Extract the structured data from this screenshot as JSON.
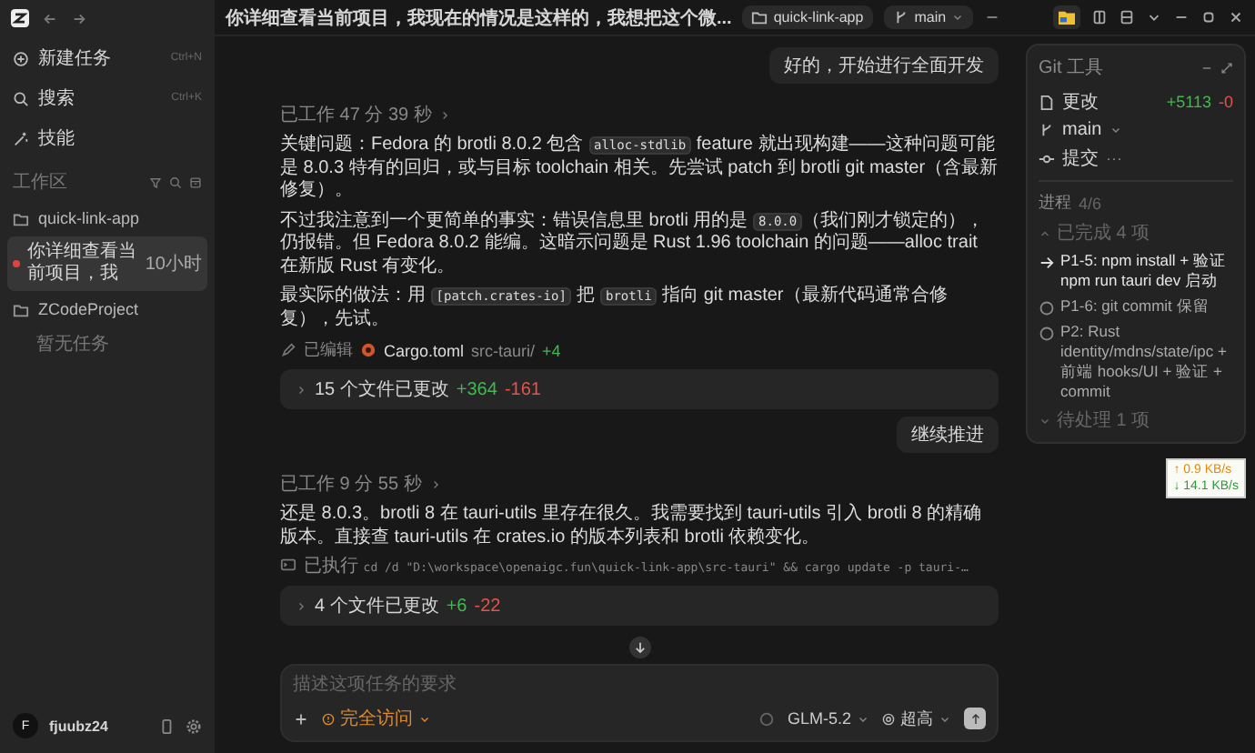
{
  "sidebar": {
    "nav": [
      {
        "kind": "new",
        "label": "新建任务",
        "shortcut": "Ctrl+N"
      },
      {
        "kind": "search",
        "label": "搜索",
        "shortcut": "Ctrl+K"
      },
      {
        "kind": "skills",
        "label": "技能"
      }
    ],
    "workspace_label": "工作区",
    "projects": [
      {
        "name": "quick-link-app",
        "tasks": [
          {
            "title": "你详细查看当前项目，我",
            "time": "10小时",
            "selected": true,
            "color": "#e0443e"
          }
        ]
      },
      {
        "name": "ZCodeProject",
        "empty": "暂无任务"
      }
    ],
    "user": {
      "initial": "F",
      "name": "fjuubz24"
    }
  },
  "topbar": {
    "title": "你详细查看当前项目，我现在的情况是这样的，我想把这个微...",
    "project": "quick-link-app",
    "branch": "main"
  },
  "messages": [
    {
      "kind": "user",
      "text": "好的，开始进行全面开发"
    },
    {
      "kind": "worked",
      "text": "已工作 47 分 39 秒"
    },
    {
      "kind": "text",
      "segments": [
        {
          "kind": "text",
          "text": "关键问题：Fedora 的 brotli 8.0.2 包含 "
        },
        {
          "kind": "code",
          "text": "alloc-stdlib"
        },
        {
          "kind": "text",
          "text": " feature 就出现构建——这种问题可能是 8.0.3 特有的回归，或与目标 toolchain 相关。先尝试 patch 到 brotli git master（含最新修复）。"
        }
      ]
    },
    {
      "kind": "text",
      "segments": [
        {
          "kind": "text",
          "text": "不过我注意到一个更简单的事实：错误信息里 brotli 用的是 "
        },
        {
          "kind": "code",
          "text": "8.0.0"
        },
        {
          "kind": "text",
          "text": "（我们刚才锁定的），仍报错。但 Fedora 8.0.2 能编。这暗示问题是 Rust 1.96 toolchain 的问题——alloc trait 在新版 Rust 有变化。"
        }
      ]
    },
    {
      "kind": "text",
      "segments": [
        {
          "kind": "text",
          "text": "最实际的做法：用 "
        },
        {
          "kind": "code",
          "text": "[patch.crates-io]"
        },
        {
          "kind": "text",
          "text": " 把 "
        },
        {
          "kind": "code",
          "text": "brotli"
        },
        {
          "kind": "text",
          "text": " 指向 git master（最新代码通常合修复），先试。"
        }
      ]
    },
    {
      "kind": "edited",
      "label": "已编辑",
      "file": "Cargo.toml",
      "path": "src-tauri/",
      "added": "+4"
    },
    {
      "kind": "changes",
      "label": "15 个文件已更改",
      "added": "+364",
      "removed": "-161"
    },
    {
      "kind": "user",
      "text": "继续推进"
    },
    {
      "kind": "worked",
      "text": "已工作 9 分 55 秒"
    },
    {
      "kind": "text",
      "segments": [
        {
          "kind": "text",
          "text": "还是 8.0.3。brotli 8 在 tauri-utils 里存在很久。我需要找到 tauri-utils 引入 brotli 8 的精确版本。直接查 tauri-utils 在 crates.io 的版本列表和 brotli 依赖变化。"
        }
      ]
    },
    {
      "kind": "command",
      "label": "已执行",
      "command": "cd /d \"D:\\workspace\\openaigc.fun\\quick-link-app\\src-tauri\" && cargo update -p tauri-…"
    },
    {
      "kind": "changes",
      "label": "4 个文件已更改",
      "added": "+6",
      "removed": "-22"
    }
  ],
  "composer": {
    "placeholder": "描述这项任务的要求",
    "access": "完全访问",
    "model": "GLM-5.2",
    "effort": "超高"
  },
  "git_panel": {
    "title": "Git 工具",
    "rows": [
      {
        "kind": "changes",
        "label": "更改",
        "added": "+5113",
        "removed": "-0"
      },
      {
        "kind": "branch",
        "label": "main"
      },
      {
        "kind": "commit",
        "label": "提交",
        "extra": "···"
      }
    ],
    "progress_label": "进程",
    "progress_count": "4/6",
    "done_label": "已完成 4 项",
    "items": [
      {
        "kind": "current",
        "text": "P1-5: npm install + 验证 npm run tauri dev 启动"
      },
      {
        "kind": "pending",
        "text": "P1-6: git commit 保留"
      },
      {
        "kind": "pending",
        "text": "P2: Rust identity/mdns/state/ipc + 前端 hooks/UI + 验证 + commit"
      }
    ],
    "pending_label": "待处理 1 项"
  },
  "net_speed": {
    "up": "↑ 0.9 KB/s",
    "down": "↓ 14.1 KB/s"
  }
}
